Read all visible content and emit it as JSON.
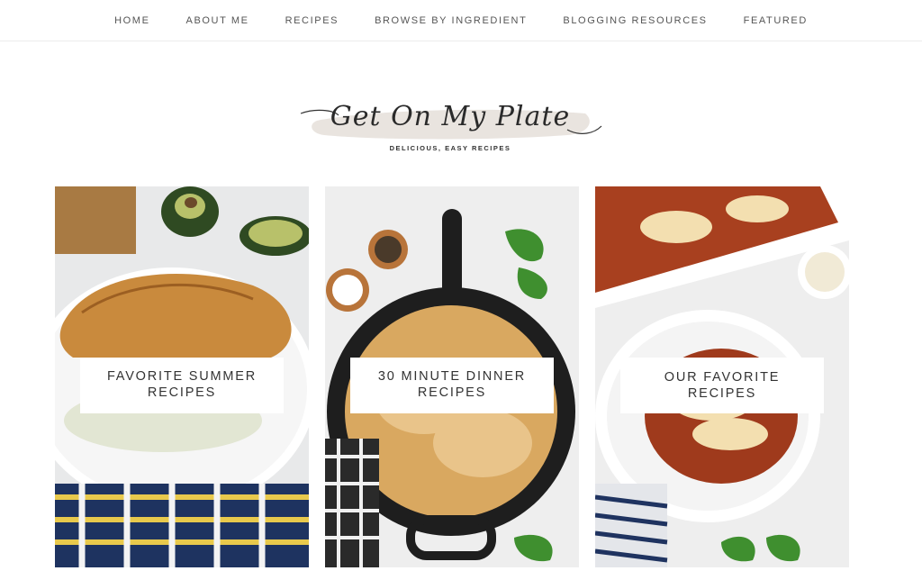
{
  "nav": {
    "items": [
      {
        "label": "HOME"
      },
      {
        "label": "ABOUT ME"
      },
      {
        "label": "RECIPES"
      },
      {
        "label": "BROWSE BY INGREDIENT"
      },
      {
        "label": "BLOGGING RESOURCES"
      },
      {
        "label": "FEATURED"
      }
    ]
  },
  "logo": {
    "script": "Get On My Plate",
    "tagline": "DELICIOUS, EASY RECIPES"
  },
  "cards": [
    {
      "label": "FAVORITE SUMMER RECIPES"
    },
    {
      "label": "30 MINUTE DINNER RECIPES"
    },
    {
      "label": "OUR FAVORITE RECIPES"
    }
  ]
}
